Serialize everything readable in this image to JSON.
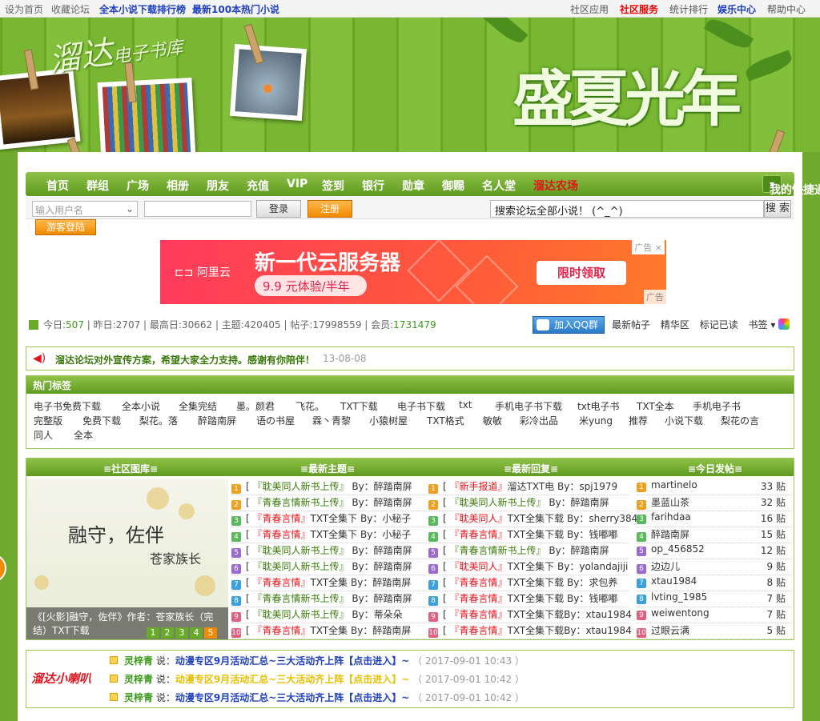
{
  "topbar": {
    "left": [
      "设为首页",
      "收藏论坛"
    ],
    "blue_links": [
      "全本小说下载排行榜",
      "最新100本热门小说"
    ],
    "right": [
      "社区应用",
      "社区服务",
      "统计排行",
      "娱乐中心",
      "帮助中心"
    ]
  },
  "banner": {
    "logo_main": "溜达",
    "logo_sub": "电子书库",
    "slogan": "盛夏光年"
  },
  "nav": {
    "items": [
      "首页",
      "群组",
      "广场",
      "相册",
      "朋友",
      "充值",
      "VIP",
      "签到",
      "银行",
      "勋章",
      "御赐",
      "名人堂"
    ],
    "special": "溜达农场",
    "quick": "我的快捷通道"
  },
  "login": {
    "username_placeholder": "输入用户名",
    "login": "登录",
    "register": "注册",
    "search_value": "搜索论坛全部小说！ (^_^)",
    "search_button": "搜 索",
    "guest": "游客登陆"
  },
  "ad": {
    "brand": "阿里云",
    "headline": "新一代云服务器",
    "price": "9.9 元体验/半年",
    "cta": "限时领取",
    "tag": "广告",
    "tag_bottom": "广告",
    "close": "×"
  },
  "stats": {
    "today_label": "今日:",
    "today": "507",
    "yesterday_label": "昨日:",
    "yesterday": "2707",
    "max_label": "最高日:",
    "max": "30662",
    "topics_label": "主题:",
    "topics": "420405",
    "posts_label": "帖子:",
    "posts": "17998559",
    "members_label": "会员:",
    "members": "1731479"
  },
  "links": {
    "qq": "加入QQ群",
    "items": [
      "最新帖子",
      "精华区",
      "标记已读",
      "书签 ▾"
    ]
  },
  "notice": {
    "text": "溜达论坛对外宣传方案，希望大家全力支持。感谢有你陪伴！",
    "date": "13-08-08"
  },
  "tags": {
    "title": "热门标签",
    "row1": [
      "电子书免费下载",
      "全本小说",
      "全集完结",
      "墨。颜君",
      "飞花。",
      "TXT下载",
      "电子书下载",
      "txt",
      "手机电子书下载",
      "txt电子书",
      "TXT全本",
      "手机电子书"
    ],
    "row2": [
      "完整版",
      "免费下载",
      "梨花。落",
      "醉踏南屏",
      "语の书屋",
      "霖丶青黎",
      "小猿树屋",
      "TXT格式",
      "敏敏",
      "彩冷出品",
      "米yung",
      "推荐",
      "小说下载",
      "梨花の言"
    ],
    "row3": [
      "同人",
      "全本"
    ]
  },
  "board": {
    "headers": [
      "≡社区图库≡",
      "≡最新主题≡",
      "≡最新回复≡",
      "≡今日发帖≡"
    ],
    "picture": {
      "title": "融守，佐伴",
      "author": "苍家族长",
      "caption": "《[火影]融守，佐伴》作者：苍家族长（完结）TXT下载",
      "pages": [
        "1",
        "2",
        "3",
        "4",
        "5"
      ]
    },
    "topics": [
      {
        "n": "1",
        "cat": "『耽美同人新书上传』",
        "title": "",
        "by": "By：醉踏南屏",
        "red": false
      },
      {
        "n": "2",
        "cat": "『青春言情新书上传』",
        "title": "",
        "by": "By：醉踏南屏",
        "red": false
      },
      {
        "n": "3",
        "cat": "『青春言情』",
        "title": "TXT全集下",
        "by": "By：小秘子",
        "red": true
      },
      {
        "n": "4",
        "cat": "『青春言情』",
        "title": "TXT全集下",
        "by": "By：小秘子",
        "red": true
      },
      {
        "n": "5",
        "cat": "『耽美同人新书上传』",
        "title": "",
        "by": "By：醉踏南屏",
        "red": false
      },
      {
        "n": "6",
        "cat": "『耽美同人新书上传』",
        "title": "",
        "by": "By：醉踏南屏",
        "red": false
      },
      {
        "n": "7",
        "cat": "『青春言情』",
        "title": "TXT全集",
        "by": "By：醉踏南屏",
        "red": true
      },
      {
        "n": "8",
        "cat": "『青春言情新书上传』",
        "title": "",
        "by": "By：醉踏南屏",
        "red": false
      },
      {
        "n": "9",
        "cat": "『耽美同人新书上传』",
        "title": "",
        "by": "By：蒂朵朵",
        "red": false
      },
      {
        "n": "10",
        "cat": "『青春言情』",
        "title": "TXT全集",
        "by": "By：醉踏南屏",
        "red": true
      }
    ],
    "replies": [
      {
        "n": "1",
        "cat": "『新手报道』",
        "title": "溜达TXT电",
        "by": "By：spj1979",
        "red": true
      },
      {
        "n": "2",
        "cat": "『耽美同人新书上传』",
        "title": "",
        "by": "By：醉踏南屏",
        "red": false
      },
      {
        "n": "3",
        "cat": "『耽美同人』",
        "title": "TXT全集下载",
        "by": "By：sherry3848",
        "red": true
      },
      {
        "n": "4",
        "cat": "『青春言情』",
        "title": "TXT全集下载",
        "by": "By：钱嘟嘟",
        "red": true
      },
      {
        "n": "5",
        "cat": "『青春言情新书上传』",
        "title": "",
        "by": "By：醉踏南屏",
        "red": false
      },
      {
        "n": "6",
        "cat": "『耽美同人』",
        "title": "TXT全集下",
        "by": "By：yolandajiji",
        "red": true
      },
      {
        "n": "7",
        "cat": "『青春言情』",
        "title": "TXT全集下载",
        "by": "By：求包养",
        "red": true
      },
      {
        "n": "8",
        "cat": "『青春言情』",
        "title": "TXT全集下载",
        "by": "By：钱嘟嘟",
        "red": true
      },
      {
        "n": "9",
        "cat": "『青春言情』",
        "title": "TXT全集下载By：xtau1984",
        "by": "",
        "red": true
      },
      {
        "n": "10",
        "cat": "『青春言情』",
        "title": "TXT全集下载By：xtau1984",
        "by": "",
        "red": true
      }
    ],
    "today": [
      {
        "n": "1",
        "user": "martinelo",
        "count": "33 贴"
      },
      {
        "n": "2",
        "user": "墨蓝山茶",
        "count": "32 贴"
      },
      {
        "n": "3",
        "user": "farihdaa",
        "count": "16 贴"
      },
      {
        "n": "4",
        "user": "醉踏南屏",
        "count": "15 贴"
      },
      {
        "n": "5",
        "user": "op_456852",
        "count": "12 贴"
      },
      {
        "n": "6",
        "user": "边边儿",
        "count": "9 贴"
      },
      {
        "n": "7",
        "user": "xtau1984",
        "count": "8 贴"
      },
      {
        "n": "8",
        "user": "lvting_1985",
        "count": "7 贴"
      },
      {
        "n": "9",
        "user": "weiwentong",
        "count": "7 贴"
      },
      {
        "n": "10",
        "user": "过眼云满",
        "count": "5 贴"
      }
    ]
  },
  "shout": {
    "logo": "溜达小喇叭",
    "lines": [
      {
        "user": "灵梓青",
        "say": "说：",
        "msg": "动漫专区9月活动汇总~三大活动齐上阵【点击进入】~",
        "date": "（ 2017-09-01 10:43 ）",
        "yellow": false
      },
      {
        "user": "灵梓青",
        "say": "说：",
        "msg": "动漫专区9月活动汇总~三大活动齐上阵【点击进入】~",
        "date": "（ 2017-09-01 10:42 ）",
        "yellow": true
      },
      {
        "user": "灵梓青",
        "say": "说：",
        "msg": "动漫专区9月活动汇总~三大活动齐上阵【点击进入】~",
        "date": "（ 2017-09-01 10:42 ）",
        "yellow": false
      }
    ]
  },
  "colors": {
    "green": "#6fa92e",
    "red": "#e3141c",
    "blue": "#1e3fbf",
    "orange": "#f08a00"
  }
}
